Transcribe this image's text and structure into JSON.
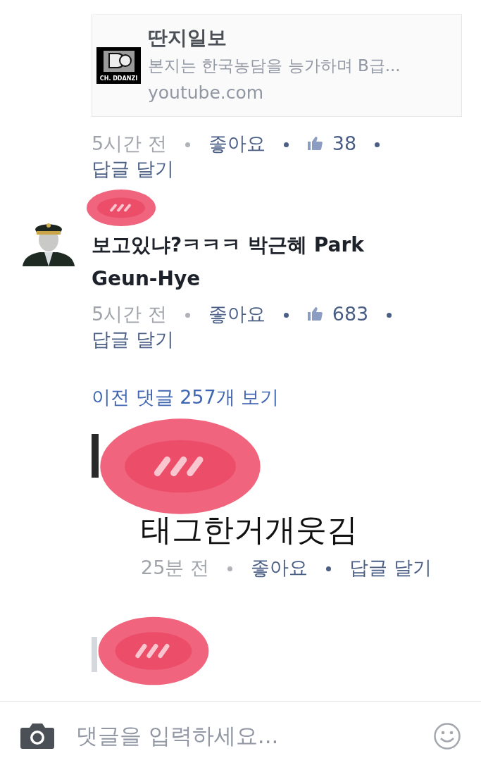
{
  "comments": [
    {
      "kind": "link",
      "link_preview": {
        "logo_text": "CH. DDANZI",
        "title": "딴지일보",
        "description": "본지는 한국농담을 능가하며 B급...",
        "domain": "youtube.com"
      },
      "time": "5시간 전",
      "like": "좋아요",
      "likes": "38",
      "reply": "답글 달기"
    },
    {
      "kind": "text",
      "name_redacted": true,
      "body": "보고있냐?ㅋㅋㅋ 박근혜 Park Geun-Hye",
      "time": "5시간 전",
      "like": "좋아요",
      "likes": "683",
      "reply": "답글 달기"
    }
  ],
  "more_comments": "이전 댓글 257개 보기",
  "replies": [
    {
      "kind": "text",
      "name_redacted": true,
      "body": "태그한거개웃김",
      "time": "25분 전",
      "like": "좋아요",
      "reply": "답글 달기"
    },
    {
      "kind": "hidden",
      "name_redacted": true
    }
  ],
  "composer": {
    "placeholder": "댓글을 입력하세요..."
  }
}
